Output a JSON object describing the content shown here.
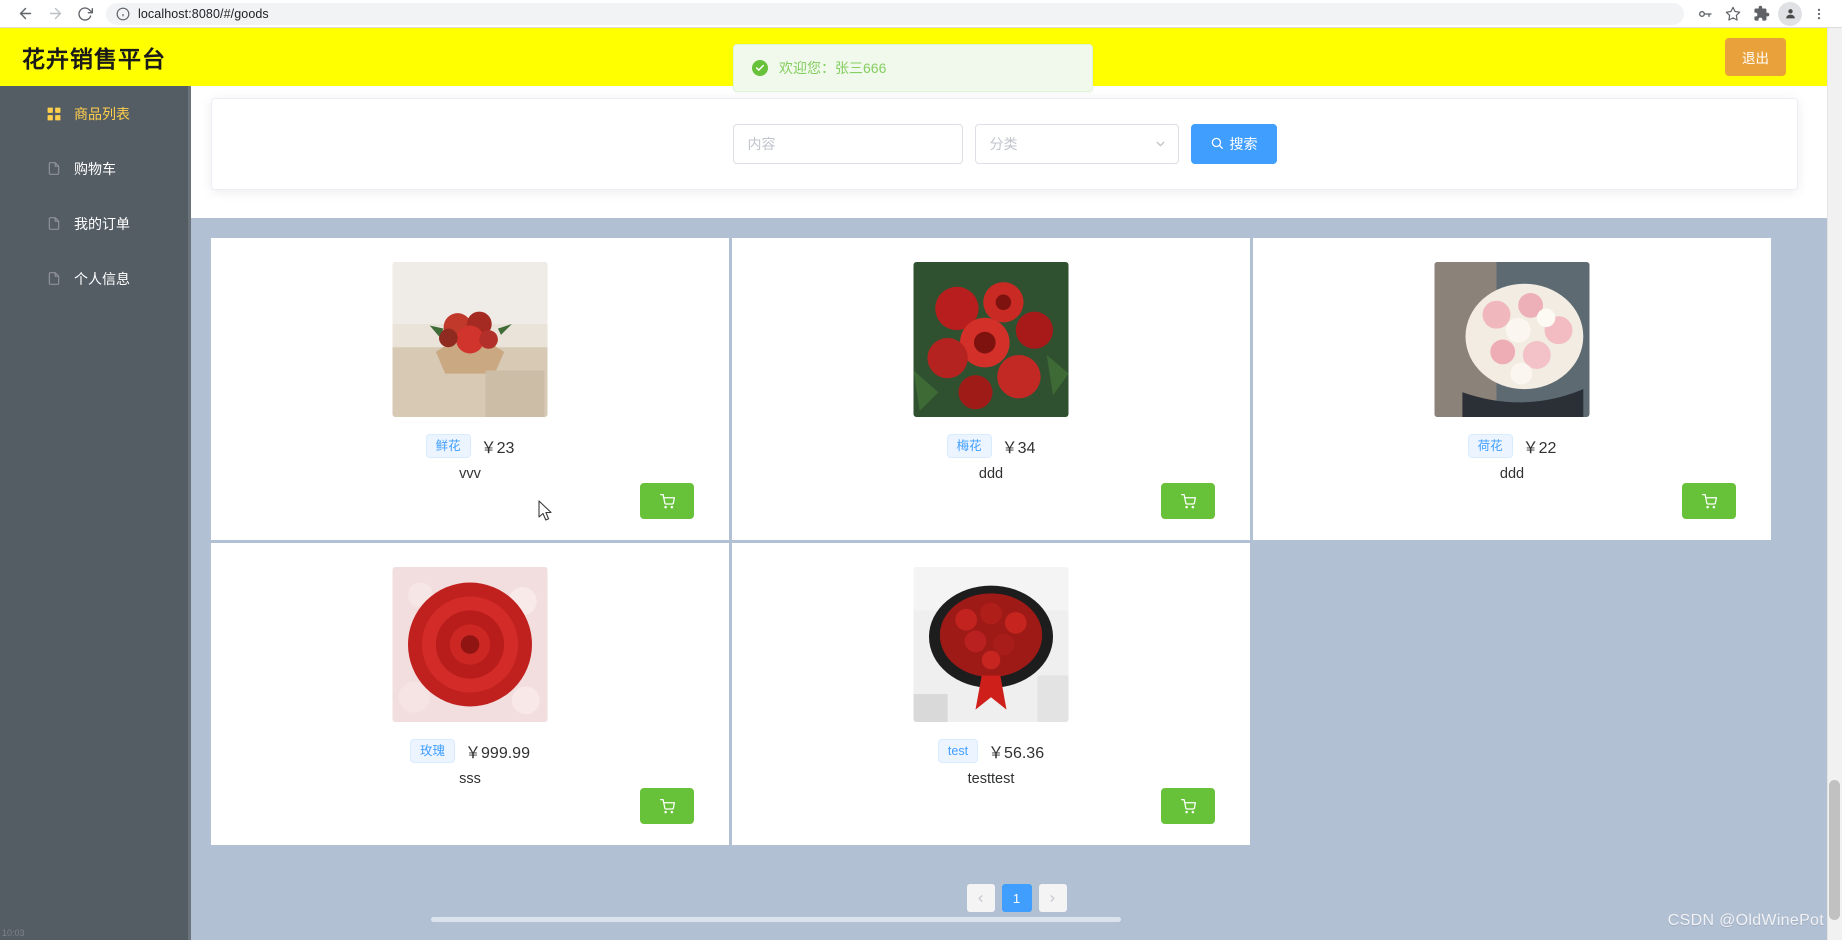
{
  "browser": {
    "url": "localhost:8080/#/goods",
    "icons": {
      "back": "back-arrow-icon",
      "forward": "forward-arrow-icon",
      "reload": "reload-icon",
      "site_info": "info-circle-icon",
      "password": "key-icon",
      "bookmark": "star-icon",
      "extensions": "puzzle-icon",
      "profile": "profile-avatar-icon",
      "menu": "three-dot-menu-icon"
    }
  },
  "header": {
    "title": "花卉销售平台",
    "logout_label": "退出",
    "background_color": "#ffff00",
    "logout_color": "#e9a23b"
  },
  "toast": {
    "text": "欢迎您：张三666",
    "icon": "success-check-icon",
    "color": "#67c23a",
    "background": "#f0f9eb"
  },
  "sidebar": {
    "background_color": "#545c64",
    "active_color": "#ffd04b",
    "items": [
      {
        "label": "商品列表",
        "icon": "grid-menu-icon",
        "active": true
      },
      {
        "label": "购物车",
        "icon": "document-icon",
        "active": false
      },
      {
        "label": "我的订单",
        "icon": "document-icon",
        "active": false
      },
      {
        "label": "个人信息",
        "icon": "document-icon",
        "active": false
      }
    ]
  },
  "search": {
    "content_placeholder": "内容",
    "content_value": "",
    "category_placeholder": "分类",
    "category_value": "",
    "button_label": "搜索",
    "button_icon": "search-icon",
    "button_color": "#409eff"
  },
  "goods": {
    "area_background": "#b2c0d4",
    "cart_icon": "shopping-cart-icon",
    "cart_button_color": "#67c23a",
    "items": [
      {
        "tag": "鲜花",
        "price": "￥23",
        "name": "vvv",
        "image": "rose-bouquet-in-kraft-paper-photo"
      },
      {
        "tag": "梅花",
        "price": "￥34",
        "name": "ddd",
        "image": "red-roses-closeup-photo"
      },
      {
        "tag": "荷花",
        "price": "￥22",
        "name": "ddd",
        "image": "pink-white-rose-bouquet-photo"
      },
      {
        "tag": "玫瑰",
        "price": "￥999.99",
        "name": "sss",
        "image": "single-red-rose-photo"
      },
      {
        "tag": "test",
        "price": "￥56.36",
        "name": "testtest",
        "image": "large-red-rose-bouquet-photo"
      }
    ]
  },
  "pagination": {
    "prev_icon": "chevron-left-icon",
    "next_icon": "chevron-right-icon",
    "current_page": "1",
    "active_color": "#409eff"
  },
  "watermark": {
    "text": "CSDN @OldWinePot"
  },
  "taskbar": {
    "time": "10:03"
  }
}
